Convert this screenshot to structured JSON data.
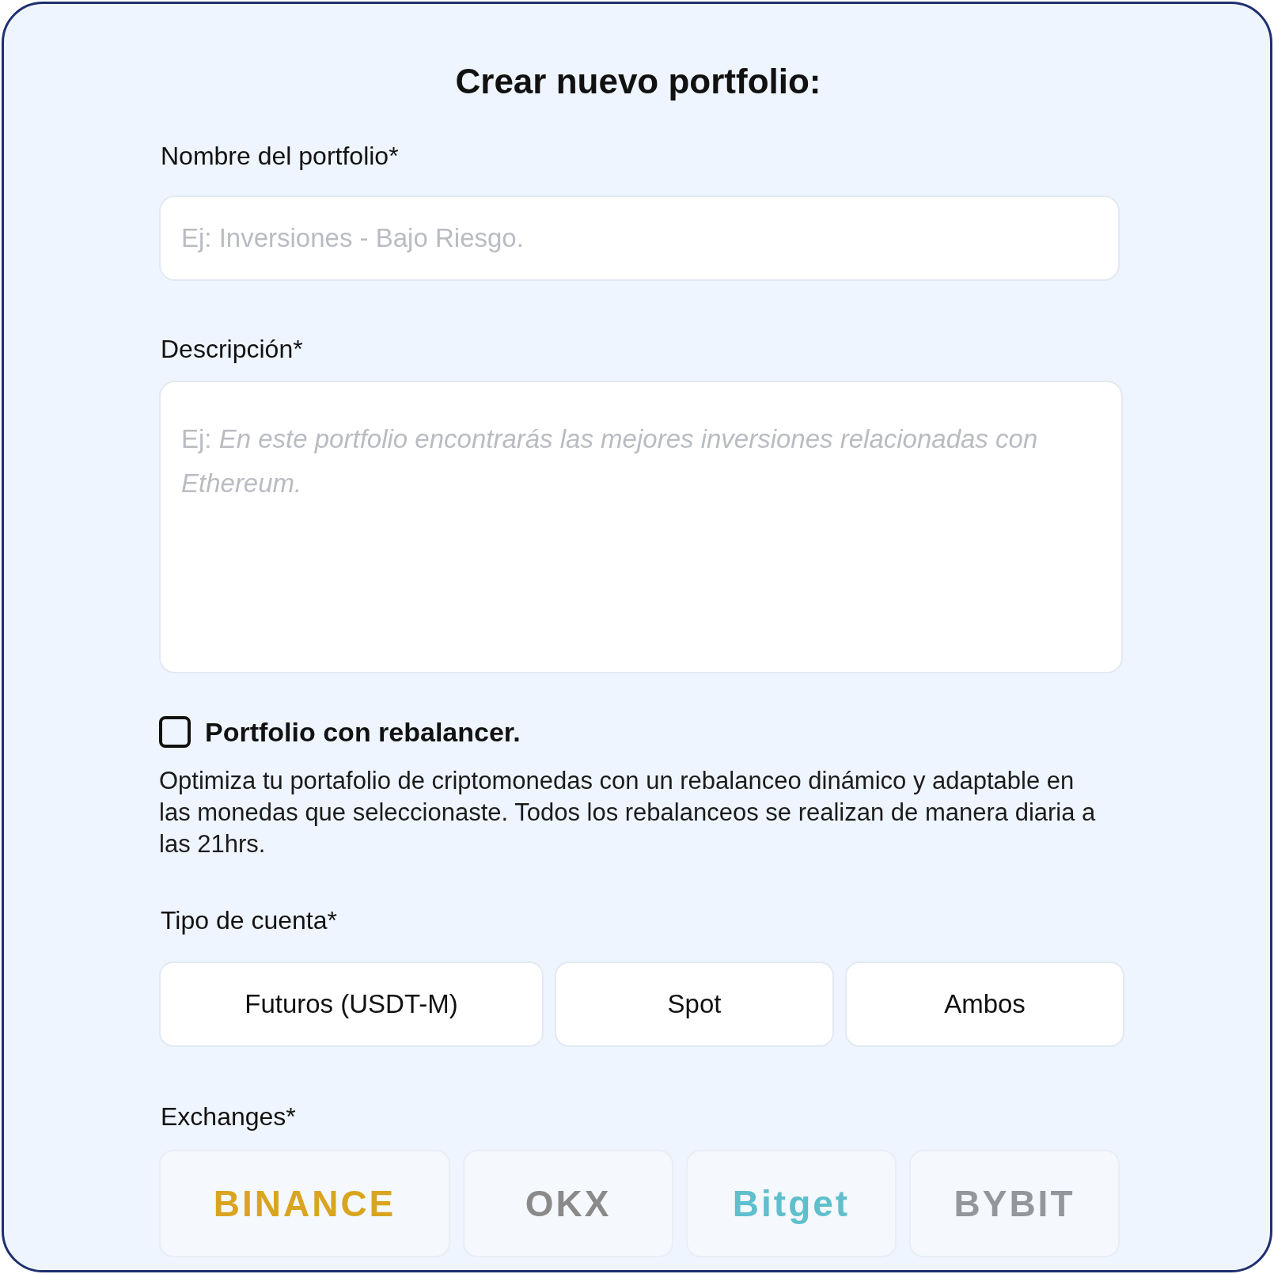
{
  "title": "Crear nuevo portfolio:",
  "name_field": {
    "label": "Nombre del portfolio*",
    "placeholder": "Ej: Inversiones - Bajo Riesgo."
  },
  "description_field": {
    "label": "Descripción*",
    "placeholder": "Ej: *En este portfolio encontrarás las mejores inversiones relacionadas con Ethereum.*"
  },
  "rebalancer": {
    "label": "Portfolio con rebalancer.",
    "checked": false,
    "description": "Optimiza tu portafolio de criptomonedas con un rebalanceo dinámico y adaptable en las monedas que seleccionaste. Todos los rebalanceos se realizan de manera diaria a las 21hrs."
  },
  "account_type": {
    "label": "Tipo de cuenta*",
    "options": [
      {
        "label": "Futuros (USDT-M)",
        "selected": false
      },
      {
        "label": "Spot",
        "selected": false
      },
      {
        "label": "Ambos",
        "selected": false
      }
    ]
  },
  "exchanges": {
    "label": "Exchanges*",
    "items": [
      {
        "name": "BINANCE",
        "color": "#d9a520",
        "selected": false
      },
      {
        "name": "OKX",
        "color": "#8a8a8a",
        "selected": false
      },
      {
        "name": "Bitget",
        "color": "#5fbfcc",
        "selected": false
      },
      {
        "name": "BYBIT",
        "color": "#94969e",
        "selected": false
      }
    ]
  }
}
